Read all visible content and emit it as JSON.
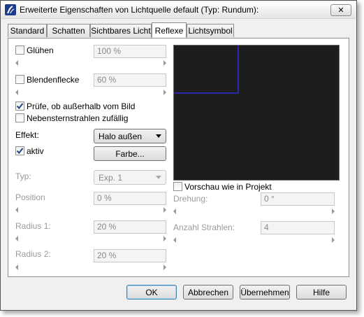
{
  "window": {
    "title": "Erweiterte Eigenschaften von Lichtquelle default (Typ: Rundum):",
    "close_symbol": "✕"
  },
  "tabs": [
    {
      "label": "Standard",
      "active": false
    },
    {
      "label": "Schatten",
      "active": false
    },
    {
      "label": "Sichtbares Licht",
      "active": false
    },
    {
      "label": "Reflexe",
      "active": true
    },
    {
      "label": "Lichtsymbol",
      "active": false
    }
  ],
  "left": {
    "gluehen": {
      "label": "Glühen",
      "checked": false,
      "value": "100 %"
    },
    "blendenflecke": {
      "label": "Blendenflecke",
      "checked": false,
      "value": "60 %"
    },
    "pruefe": {
      "label": "Prüfe, ob außerhalb vom Bild",
      "checked": true
    },
    "nebensternstrahlen": {
      "label": "Nebensternstrahlen zufällig",
      "checked": false
    },
    "effekt": {
      "label": "Effekt:",
      "selected": "Halo außen"
    },
    "aktiv": {
      "label": "aktiv",
      "checked": true
    },
    "farbe_label": "Farbe...",
    "typ": {
      "label": "Typ:",
      "selected": "Exp. 1"
    },
    "position": {
      "label": "Position",
      "value": "0 %"
    },
    "radius1": {
      "label": "Radius 1:",
      "value": "20 %"
    },
    "radius2": {
      "label": "Radius 2:",
      "value": "20 %"
    }
  },
  "right": {
    "preview": {
      "background": "#1d1d1d",
      "line_color": "#2a2aa8"
    },
    "vorschau": {
      "label": "Vorschau wie in Projekt",
      "checked": false
    },
    "drehung": {
      "label": "Drehung:",
      "value": "0 °"
    },
    "strahlen": {
      "label": "Anzahl Strahlen:",
      "value": "4"
    }
  },
  "buttons": {
    "ok": "OK",
    "abbrechen": "Abbrechen",
    "uebernehmen": "Übernehmen",
    "hilfe": "Hilfe"
  },
  "colors": {
    "accent_border": "#3c7fb1",
    "check_mark": "#1f3f7f"
  }
}
